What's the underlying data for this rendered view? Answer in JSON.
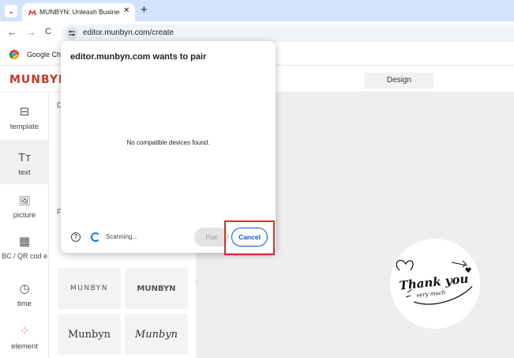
{
  "browser": {
    "tab_menu_glyph": "⌄",
    "tab_title": "MUNBYN: Unleash Business Cre",
    "tab_close_glyph": "✕",
    "new_tab_glyph": "+",
    "back_glyph": "←",
    "forward_glyph": "→",
    "reload_glyph": "C",
    "url": "editor.munbyn.com/create",
    "bookmark_label": "Google Chro",
    "colors": {
      "tabbar": "#d3e3fd",
      "favicon": "#e53935"
    }
  },
  "app": {
    "logo": "MUNBYN",
    "design_tab": "Design",
    "sidebar": [
      {
        "icon": "template-icon",
        "glyph": "⊟",
        "label": "template"
      },
      {
        "icon": "text-icon",
        "glyph": "Tт",
        "label": "text"
      },
      {
        "icon": "picture-icon",
        "glyph": "🖼",
        "label": "picture"
      },
      {
        "icon": "barcode-qr-icon",
        "glyph": "▦",
        "label": "BC / QR cod e"
      },
      {
        "icon": "clock-icon",
        "glyph": "◷",
        "label": "time"
      },
      {
        "icon": "element-icon",
        "glyph": "⁘",
        "label": "element"
      }
    ],
    "panel": {
      "label_1": "D",
      "label_2": "F",
      "font_samples": [
        "MUNBYN",
        "MUNBYN",
        "Munbyn",
        "Munbyn"
      ],
      "collapse_glyph": "‹"
    },
    "canvas_art": {
      "line1": "Thank you",
      "line2": "very much"
    }
  },
  "dialog": {
    "title": "editor.munbyn.com wants to pair",
    "empty_message": "No compatible devices found.",
    "help_glyph": "?",
    "scanning_text": "Scanning...",
    "pair_label": "Pair",
    "cancel_label": "Cancel",
    "colors": {
      "accent": "#0b57d0",
      "highlight": "#d32f2f"
    }
  }
}
